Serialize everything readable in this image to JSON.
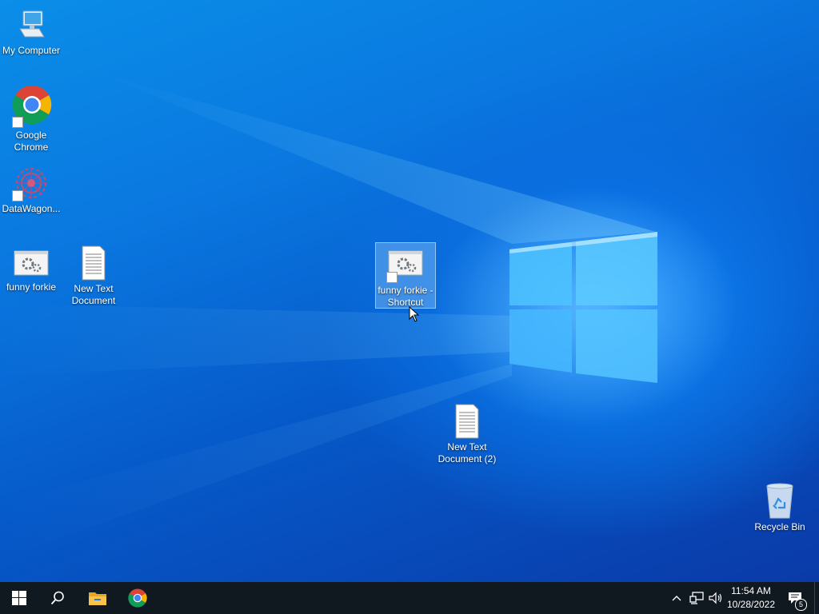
{
  "desktop_icons": {
    "my_computer": "My Computer",
    "google_chrome": "Google Chrome",
    "datawagon": "DataWagon...",
    "funny_forkie": "funny forkie",
    "new_text_document": "New Text Document",
    "funny_forkie_shortcut": "funny forkie - Shortcut",
    "new_text_document_2": "New Text Document (2)",
    "recycle_bin": "Recycle Bin"
  },
  "taskbar": {
    "pinned": [
      "start-icon",
      "search-icon",
      "file-explorer-icon",
      "chrome-icon"
    ],
    "tray": {
      "time": "11:54 AM",
      "date": "10/28/2022",
      "notification_count": "5"
    }
  },
  "colors": {
    "desktop_blue": "#0a78e0",
    "taskbar": "#101820",
    "selection": "#aad7ff"
  }
}
